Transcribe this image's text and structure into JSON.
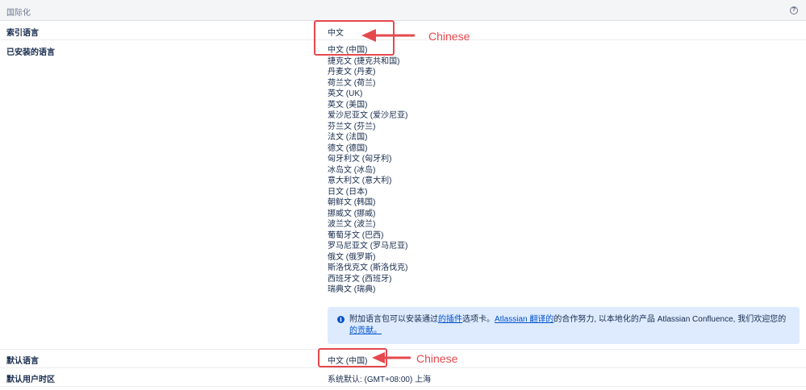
{
  "header": {
    "title": "国际化",
    "help_icon": "?"
  },
  "rows": {
    "index_language": {
      "label": "索引语言",
      "value": "中文"
    },
    "installed_languages": {
      "label": "已安装的语言",
      "items": [
        "中文 (中国)",
        "捷克文 (捷克共和国)",
        "丹麦文 (丹麦)",
        "荷兰文 (荷兰)",
        "英文 (UK)",
        "英文 (美国)",
        "爱沙尼亚文 (爱沙尼亚)",
        "芬兰文 (芬兰)",
        "法文 (法国)",
        "德文 (德国)",
        "匈牙利文 (匈牙利)",
        "冰岛文 (冰岛)",
        "意大利文 (意大利)",
        "日文 (日本)",
        "朝鲜文 (韩国)",
        "挪威文 (挪威)",
        "波兰文 (波兰)",
        "葡萄牙文 (巴西)",
        "罗马尼亚文 (罗马尼亚)",
        "俄文 (俄罗斯)",
        "斯洛伐克文 (斯洛伐克)",
        "西班牙文 (西班牙)",
        "瑞典文 (瑞典)"
      ]
    },
    "default_language": {
      "label": "默认语言",
      "value": "中文 (中国)"
    },
    "default_timezone": {
      "label": "默认用户时区",
      "value": "系统默认: (GMT+08:00) 上海"
    }
  },
  "info": {
    "icon": "i",
    "text_1": "附加语言包可以安装通过",
    "link_plugins": "的插件",
    "text_2": "选项卡。",
    "link_translate": "Atlassian 翻译的",
    "text_3": "的合作努力, 以本地化的产品 Atlassian Confluence, 我们欢迎您的",
    "link_contribution": "的贡献。"
  },
  "annotations": {
    "top_label": "Chinese",
    "bottom_label": "Chinese",
    "color": "#e5484d"
  }
}
